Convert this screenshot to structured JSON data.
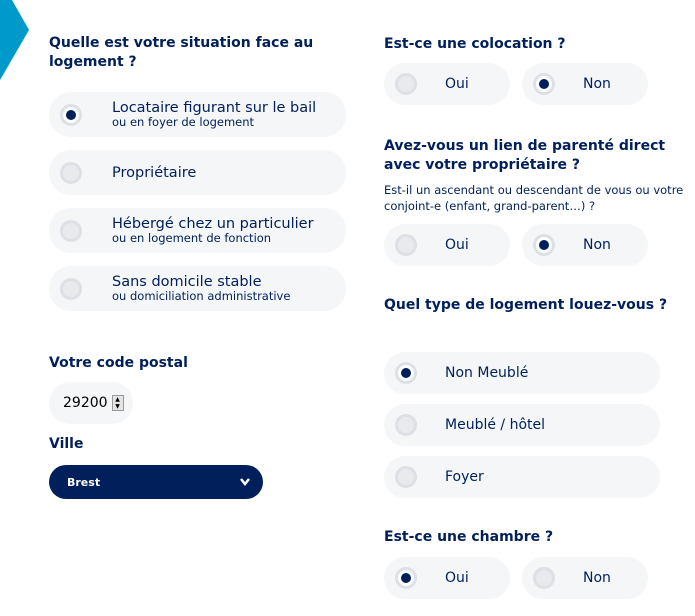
{
  "colors": {
    "navy": "#001f5b",
    "accent": "#0099cc",
    "pill": "#f5f6f8"
  },
  "situation": {
    "question": "Quelle est votre situation face au logement ?",
    "options": [
      {
        "label": "Locataire figurant sur le bail",
        "sub": "ou en foyer de logement",
        "selected": true
      },
      {
        "label": "Propriétaire",
        "sub": "",
        "selected": false
      },
      {
        "label": "Hébergé chez un particulier",
        "sub": "ou en logement de fonction",
        "selected": false
      },
      {
        "label": "Sans domicile stable",
        "sub": "ou domiciliation administrative",
        "selected": false
      }
    ]
  },
  "postal": {
    "label": "Votre code postal",
    "value": "29200"
  },
  "ville": {
    "label": "Ville",
    "value": "Brest"
  },
  "colocation": {
    "question": "Est-ce une colocation ?",
    "options": [
      {
        "label": "Oui",
        "selected": false
      },
      {
        "label": "Non",
        "selected": true
      }
    ]
  },
  "parente": {
    "question": "Avez-vous un lien de parenté direct avec votre propriétaire ?",
    "hint": "Est-il un ascendant ou descendant de vous ou votre conjoint-e (enfant, grand-parent…) ?",
    "options": [
      {
        "label": "Oui",
        "selected": false
      },
      {
        "label": "Non",
        "selected": true
      }
    ]
  },
  "type": {
    "question": "Quel type de logement louez-vous ?",
    "options": [
      {
        "label": "Non Meublé",
        "selected": true
      },
      {
        "label": "Meublé / hôtel",
        "selected": false
      },
      {
        "label": "Foyer",
        "selected": false
      }
    ]
  },
  "chambre": {
    "question": "Est-ce une chambre ?",
    "options": [
      {
        "label": "Oui",
        "selected": true
      },
      {
        "label": "Non",
        "selected": false
      }
    ]
  }
}
